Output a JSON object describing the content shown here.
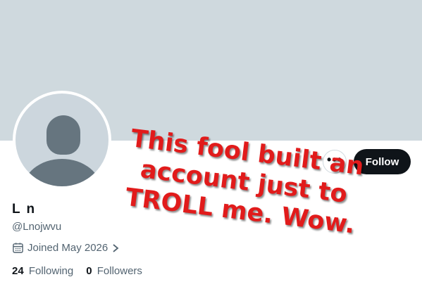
{
  "profile": {
    "display_name": "L n",
    "handle": "@Lnojwvu",
    "joined": "Joined May 2026",
    "following_count": "24",
    "following_label": "Following",
    "followers_count": "0",
    "followers_label": "Followers"
  },
  "actions": {
    "follow_label": "Follow",
    "more_label": "•••"
  },
  "overlay": {
    "lines": [
      "This fool built an",
      "account just to",
      "TROLL me. Wow."
    ]
  },
  "icons": [
    "calendar-icon",
    "chevron-right-icon",
    "more-icon"
  ],
  "colors": {
    "banner": "#cfd9de",
    "follow_bg": "#0f1419",
    "overlay_text": "#e11b1b",
    "secondary_text": "#536471"
  }
}
